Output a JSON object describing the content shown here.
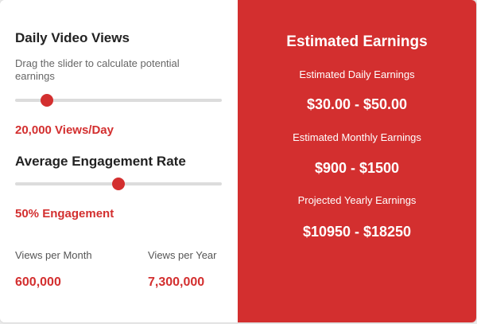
{
  "views_section": {
    "heading": "Daily Video Views",
    "hint": "Drag the slider to calculate potential earnings",
    "slider_value": 0.155,
    "value_text": "20,000 Views/Day"
  },
  "engagement_section": {
    "heading": "Average Engagement Rate",
    "slider_value": 0.5,
    "value_text": "50% Engagement"
  },
  "stats": {
    "monthly_label": "Views per Month",
    "monthly_value": "600,000",
    "yearly_label": "Views per Year",
    "yearly_value": "7,300,000"
  },
  "earnings": {
    "title": "Estimated Earnings",
    "daily_label": "Estimated Daily Earnings",
    "daily_value": "$30.00 - $50.00",
    "monthly_label": "Estimated Monthly Earnings",
    "monthly_value": "$900 - $1500",
    "yearly_label": "Projected Yearly Earnings",
    "yearly_value": "$10950 - $18250"
  },
  "colors": {
    "accent": "#d32f2f",
    "track": "#dcdcdc"
  }
}
